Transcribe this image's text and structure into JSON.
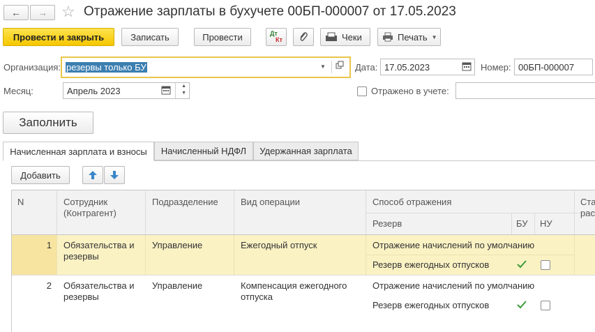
{
  "window": {
    "title": "Отражение зарплаты в бухучете 00БП-000007 от 17.05.2023"
  },
  "toolbar": {
    "post_close": "Провести и закрыть",
    "save": "Записать",
    "post": "Провести",
    "dt_kt_top": "Дт",
    "dt_kt_bottom": "Кт",
    "receipts": "Чеки",
    "print": "Печать"
  },
  "form": {
    "organization_label": "Организация:",
    "organization_value": "резервы только БУ",
    "date_label": "Дата:",
    "date_value": "17.05.2023",
    "number_label": "Номер:",
    "number_value": "00БП-000007",
    "month_label": "Месяц:",
    "month_value": "Апрель 2023",
    "reflected_label": "Отражено в учете:",
    "reflected_value": ""
  },
  "fill_button": "Заполнить",
  "tabs": [
    {
      "label": "Начисленная зарплата и взносы",
      "active": true
    },
    {
      "label": "Начисленный НДФЛ",
      "active": false
    },
    {
      "label": "Удержанная зарплата",
      "active": false
    }
  ],
  "table_toolbar": {
    "add": "Добавить"
  },
  "table": {
    "headers": {
      "n": "N",
      "employee": "Сотрудник\n(Контрагент)",
      "department": "Подразделение",
      "operation": "Вид операции",
      "reflection": "Способ отражения",
      "reserve": "Резерв",
      "bu": "БУ",
      "nu": "НУ",
      "status_cut": "Стат\nрасх"
    },
    "rows": [
      {
        "n": "1",
        "employee": "Обязательства и\nрезервы",
        "department": "Управление",
        "operation": "Ежегодный отпуск",
        "reflection": "Отражение начислений по умолчанию",
        "reserve": "Резерв ежегодных отпусков",
        "bu": true,
        "nu": false,
        "selected": true
      },
      {
        "n": "2",
        "employee": "Обязательства и\nрезервы",
        "department": "Управление",
        "operation": "Компенсация ежегодного\nотпуска",
        "reflection": "Отражение начислений по умолчанию",
        "reserve": "Резерв ежегодных отпусков",
        "bu": true,
        "nu": false,
        "selected": false
      }
    ]
  },
  "colors": {
    "primary_button": "#f6c700",
    "selected_row": "#fbf2c4",
    "selected_n_cell": "#f6e4a0",
    "focus_border": "#e8c64b",
    "selection_highlight": "#3c7fb1",
    "check_green": "#3c9a3c"
  }
}
